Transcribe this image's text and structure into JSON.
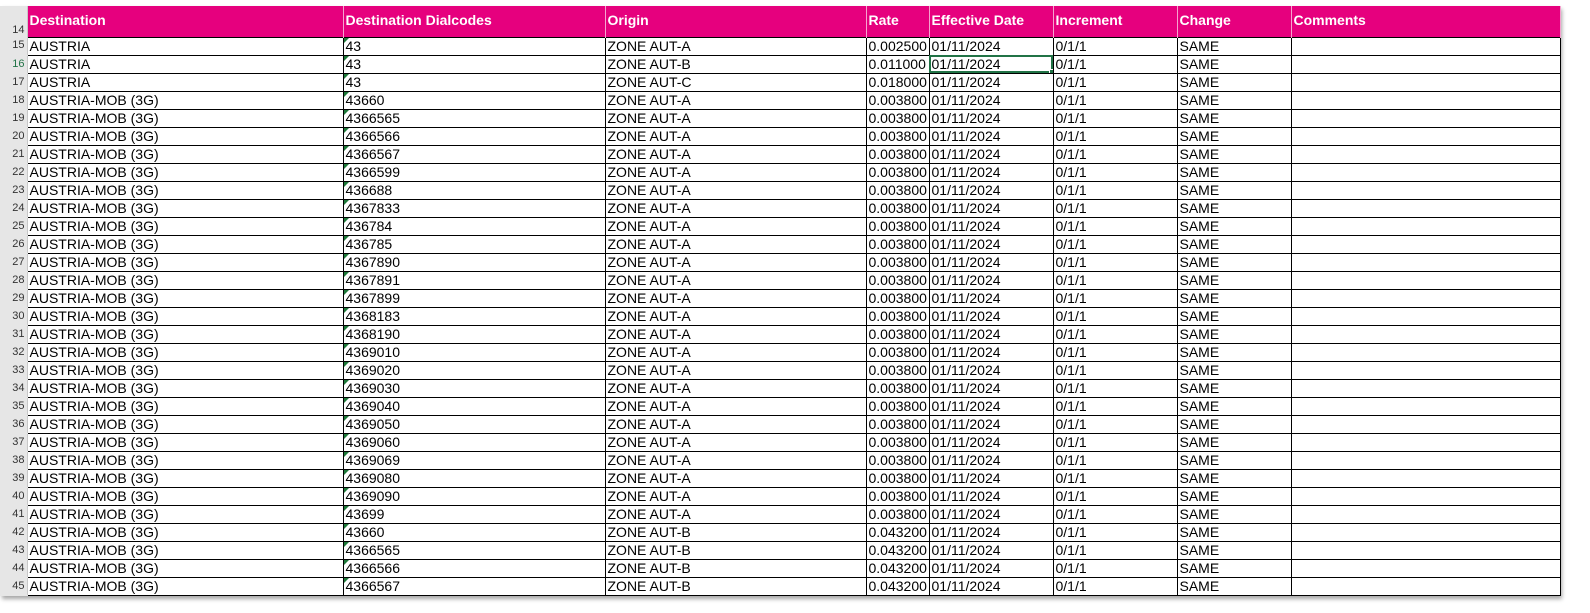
{
  "header_row_number": "14",
  "columns": [
    "Destination",
    "Destination Dialcodes",
    "Origin",
    "Rate",
    "Effective Date",
    "Increment",
    "Change",
    "Comments"
  ],
  "rows": [
    {
      "n": "15",
      "cells": [
        "AUSTRIA",
        "43",
        "ZONE AUT-A",
        "0.002500",
        "01/11/2024",
        "0/1/1",
        "SAME",
        ""
      ]
    },
    {
      "n": "16",
      "cells": [
        "AUSTRIA",
        "43",
        "ZONE AUT-B",
        "0.011000",
        "01/11/2024",
        "0/1/1",
        "SAME",
        ""
      ]
    },
    {
      "n": "17",
      "cells": [
        "AUSTRIA",
        "43",
        "ZONE AUT-C",
        "0.018000",
        "01/11/2024",
        "0/1/1",
        "SAME",
        ""
      ]
    },
    {
      "n": "18",
      "cells": [
        "AUSTRIA-MOB (3G)",
        "43660",
        "ZONE AUT-A",
        "0.003800",
        "01/11/2024",
        "0/1/1",
        "SAME",
        ""
      ]
    },
    {
      "n": "19",
      "cells": [
        "AUSTRIA-MOB (3G)",
        "4366565",
        "ZONE AUT-A",
        "0.003800",
        "01/11/2024",
        "0/1/1",
        "SAME",
        ""
      ]
    },
    {
      "n": "20",
      "cells": [
        "AUSTRIA-MOB (3G)",
        "4366566",
        "ZONE AUT-A",
        "0.003800",
        "01/11/2024",
        "0/1/1",
        "SAME",
        ""
      ]
    },
    {
      "n": "21",
      "cells": [
        "AUSTRIA-MOB (3G)",
        "4366567",
        "ZONE AUT-A",
        "0.003800",
        "01/11/2024",
        "0/1/1",
        "SAME",
        ""
      ]
    },
    {
      "n": "22",
      "cells": [
        "AUSTRIA-MOB (3G)",
        "4366599",
        "ZONE AUT-A",
        "0.003800",
        "01/11/2024",
        "0/1/1",
        "SAME",
        ""
      ]
    },
    {
      "n": "23",
      "cells": [
        "AUSTRIA-MOB (3G)",
        "436688",
        "ZONE AUT-A",
        "0.003800",
        "01/11/2024",
        "0/1/1",
        "SAME",
        ""
      ]
    },
    {
      "n": "24",
      "cells": [
        "AUSTRIA-MOB (3G)",
        "4367833",
        "ZONE AUT-A",
        "0.003800",
        "01/11/2024",
        "0/1/1",
        "SAME",
        ""
      ]
    },
    {
      "n": "25",
      "cells": [
        "AUSTRIA-MOB (3G)",
        "436784",
        "ZONE AUT-A",
        "0.003800",
        "01/11/2024",
        "0/1/1",
        "SAME",
        ""
      ]
    },
    {
      "n": "26",
      "cells": [
        "AUSTRIA-MOB (3G)",
        "436785",
        "ZONE AUT-A",
        "0.003800",
        "01/11/2024",
        "0/1/1",
        "SAME",
        ""
      ]
    },
    {
      "n": "27",
      "cells": [
        "AUSTRIA-MOB (3G)",
        "4367890",
        "ZONE AUT-A",
        "0.003800",
        "01/11/2024",
        "0/1/1",
        "SAME",
        ""
      ]
    },
    {
      "n": "28",
      "cells": [
        "AUSTRIA-MOB (3G)",
        "4367891",
        "ZONE AUT-A",
        "0.003800",
        "01/11/2024",
        "0/1/1",
        "SAME",
        ""
      ]
    },
    {
      "n": "29",
      "cells": [
        "AUSTRIA-MOB (3G)",
        "4367899",
        "ZONE AUT-A",
        "0.003800",
        "01/11/2024",
        "0/1/1",
        "SAME",
        ""
      ]
    },
    {
      "n": "30",
      "cells": [
        "AUSTRIA-MOB (3G)",
        "4368183",
        "ZONE AUT-A",
        "0.003800",
        "01/11/2024",
        "0/1/1",
        "SAME",
        ""
      ]
    },
    {
      "n": "31",
      "cells": [
        "AUSTRIA-MOB (3G)",
        "4368190",
        "ZONE AUT-A",
        "0.003800",
        "01/11/2024",
        "0/1/1",
        "SAME",
        ""
      ]
    },
    {
      "n": "32",
      "cells": [
        "AUSTRIA-MOB (3G)",
        "4369010",
        "ZONE AUT-A",
        "0.003800",
        "01/11/2024",
        "0/1/1",
        "SAME",
        ""
      ]
    },
    {
      "n": "33",
      "cells": [
        "AUSTRIA-MOB (3G)",
        "4369020",
        "ZONE AUT-A",
        "0.003800",
        "01/11/2024",
        "0/1/1",
        "SAME",
        ""
      ]
    },
    {
      "n": "34",
      "cells": [
        "AUSTRIA-MOB (3G)",
        "4369030",
        "ZONE AUT-A",
        "0.003800",
        "01/11/2024",
        "0/1/1",
        "SAME",
        ""
      ]
    },
    {
      "n": "35",
      "cells": [
        "AUSTRIA-MOB (3G)",
        "4369040",
        "ZONE AUT-A",
        "0.003800",
        "01/11/2024",
        "0/1/1",
        "SAME",
        ""
      ]
    },
    {
      "n": "36",
      "cells": [
        "AUSTRIA-MOB (3G)",
        "4369050",
        "ZONE AUT-A",
        "0.003800",
        "01/11/2024",
        "0/1/1",
        "SAME",
        ""
      ]
    },
    {
      "n": "37",
      "cells": [
        "AUSTRIA-MOB (3G)",
        "4369060",
        "ZONE AUT-A",
        "0.003800",
        "01/11/2024",
        "0/1/1",
        "SAME",
        ""
      ]
    },
    {
      "n": "38",
      "cells": [
        "AUSTRIA-MOB (3G)",
        "4369069",
        "ZONE AUT-A",
        "0.003800",
        "01/11/2024",
        "0/1/1",
        "SAME",
        ""
      ]
    },
    {
      "n": "39",
      "cells": [
        "AUSTRIA-MOB (3G)",
        "4369080",
        "ZONE AUT-A",
        "0.003800",
        "01/11/2024",
        "0/1/1",
        "SAME",
        ""
      ]
    },
    {
      "n": "40",
      "cells": [
        "AUSTRIA-MOB (3G)",
        "4369090",
        "ZONE AUT-A",
        "0.003800",
        "01/11/2024",
        "0/1/1",
        "SAME",
        ""
      ]
    },
    {
      "n": "41",
      "cells": [
        "AUSTRIA-MOB (3G)",
        "43699",
        "ZONE AUT-A",
        "0.003800",
        "01/11/2024",
        "0/1/1",
        "SAME",
        ""
      ]
    },
    {
      "n": "42",
      "cells": [
        "AUSTRIA-MOB (3G)",
        "43660",
        "ZONE AUT-B",
        "0.043200",
        "01/11/2024",
        "0/1/1",
        "SAME",
        ""
      ]
    },
    {
      "n": "43",
      "cells": [
        "AUSTRIA-MOB (3G)",
        "4366565",
        "ZONE AUT-B",
        "0.043200",
        "01/11/2024",
        "0/1/1",
        "SAME",
        ""
      ]
    },
    {
      "n": "44",
      "cells": [
        "AUSTRIA-MOB (3G)",
        "4366566",
        "ZONE AUT-B",
        "0.043200",
        "01/11/2024",
        "0/1/1",
        "SAME",
        ""
      ]
    },
    {
      "n": "45",
      "cells": [
        "AUSTRIA-MOB (3G)",
        "4366567",
        "ZONE AUT-B",
        "0.043200",
        "01/11/2024",
        "0/1/1",
        "SAME",
        ""
      ]
    }
  ],
  "active_row": "16",
  "colors": {
    "header_bg": "#e6007e",
    "header_text": "#ffffff",
    "selection": "#217346"
  }
}
